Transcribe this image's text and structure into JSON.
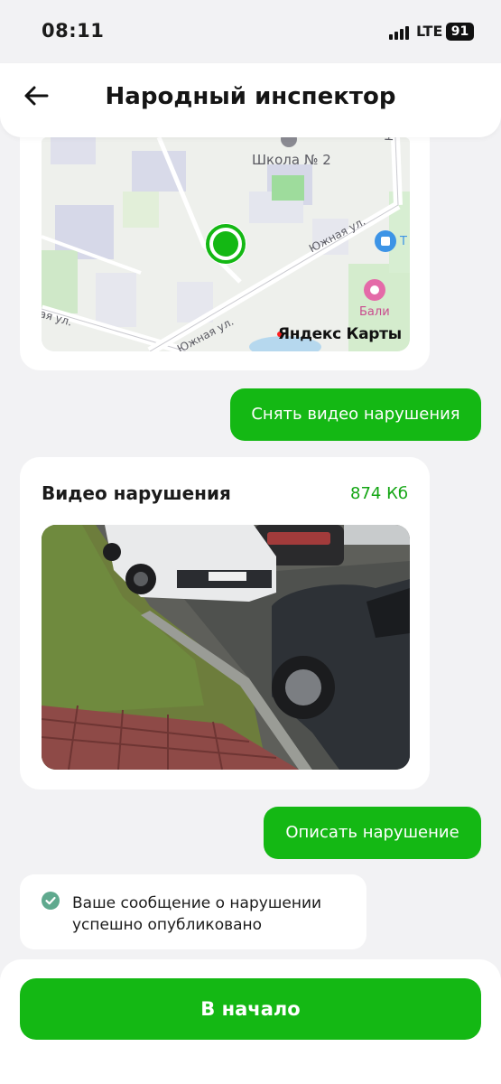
{
  "status_bar": {
    "time": "08:11",
    "network": "LTE",
    "battery": "91"
  },
  "header": {
    "title": "Народный инспектор",
    "back_icon": "arrow-left-icon"
  },
  "map": {
    "labels": {
      "school": "Школа № 2",
      "street_1": "Южная ул.",
      "street_2": "Южная ул.",
      "street_3": "ая ул.",
      "street_top": "Юж",
      "poi_bali": "Бали",
      "poi_t": "Т",
      "brand": "Яндекс Карты"
    }
  },
  "actions": {
    "record_video": "Снять видео нарушения",
    "describe": "Описать нарушение",
    "home": "В начало"
  },
  "video": {
    "label": "Видео нарушения",
    "size": "874 Кб"
  },
  "message": {
    "text": "Ваше сообщение о нарушении успешно опубликовано"
  },
  "colors": {
    "accent": "#14b814",
    "size_text": "#14a614",
    "background": "#f2f2f4"
  }
}
